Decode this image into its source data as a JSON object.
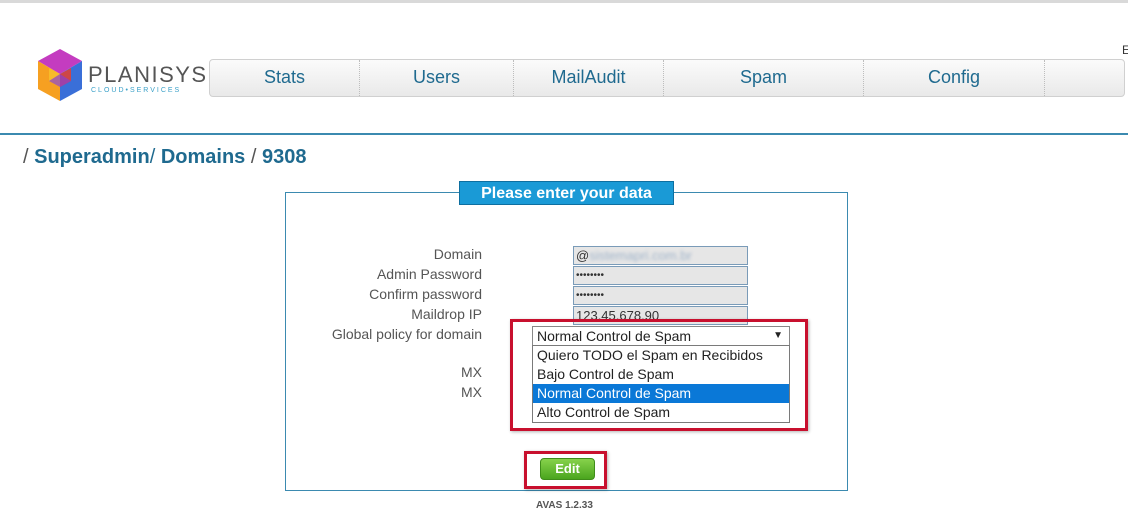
{
  "brand": {
    "name": "PLANISYS",
    "tagline": "CLOUD•SERVICES"
  },
  "nav": {
    "items": [
      "Stats",
      "Users",
      "MailAudit",
      "Spam",
      "Config",
      ""
    ]
  },
  "corner_text": "E",
  "breadcrumb": {
    "sep1": "/",
    "superadmin": "Superadmin",
    "sep2": "/",
    "domains": "Domains",
    "sep3": "/",
    "id": "9308"
  },
  "form": {
    "legend": "Please enter your data",
    "labels": {
      "domain": "Domain",
      "admin_password": "Admin Password",
      "confirm_password": "Confirm password",
      "maildrop_ip": "Maildrop IP",
      "global_policy": "Global policy for domain",
      "mx1": "MX",
      "mx2": "MX"
    },
    "values": {
      "domain_prefix": "@",
      "domain_blurred": "sistemapri.com.br",
      "admin_password": "••••••••",
      "confirm_password": "••••••••",
      "maildrop_ip": "123.45.678.90"
    },
    "policy": {
      "selected": "Normal Control de Spam",
      "options": [
        "Quiero TODO el Spam en Recibidos",
        "Bajo Control de Spam",
        "Normal Control de Spam",
        "Alto Control de Spam"
      ],
      "selected_index": 2
    },
    "edit_label": "Edit"
  },
  "footer": {
    "version": "AVAS 1.2.33"
  },
  "colors": {
    "accent": "#1f6a8f",
    "legend_bg": "#1a9ad6",
    "highlight": "#c8102e",
    "option_selected": "#0a78d7",
    "edit_button": "#4aa51e"
  }
}
